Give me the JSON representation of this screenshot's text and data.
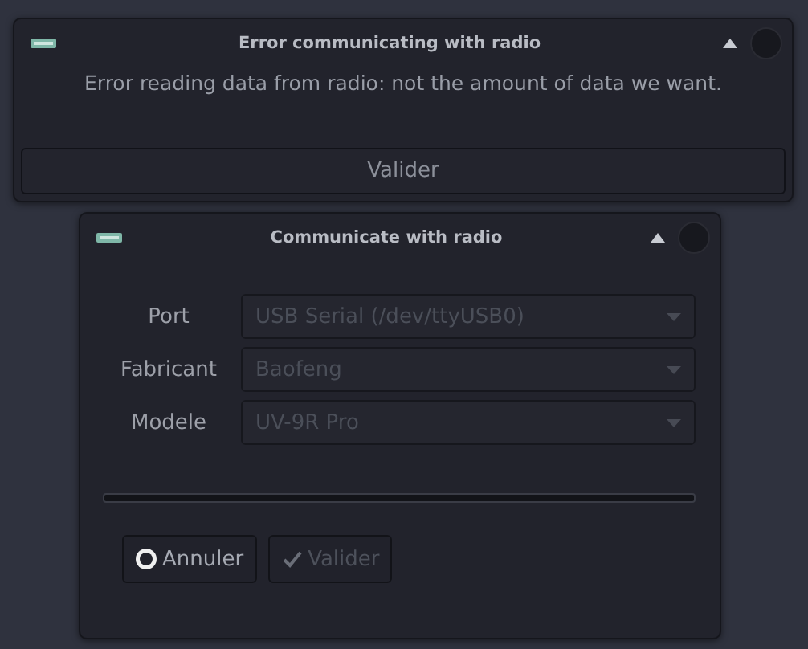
{
  "error_dialog": {
    "title": "Error communicating with radio",
    "message": "Error reading data from radio: not the amount of data we want.",
    "button": {
      "label": "Valider",
      "disabled": false
    }
  },
  "comm_dialog": {
    "title": "Communicate with radio",
    "fields": [
      {
        "label": "Port",
        "value": "USB Serial (/dev/ttyUSB0)",
        "disabled": true
      },
      {
        "label": "Fabricant",
        "value": "Baofeng",
        "disabled": true
      },
      {
        "label": "Modele",
        "value": "UV-9R Pro",
        "disabled": true
      }
    ],
    "progress": {
      "level": 0
    },
    "buttons": [
      {
        "label": "Annuler",
        "kind": "cancel",
        "disabled": false
      },
      {
        "label": "Valider",
        "kind": "ok",
        "disabled": true
      }
    ]
  }
}
